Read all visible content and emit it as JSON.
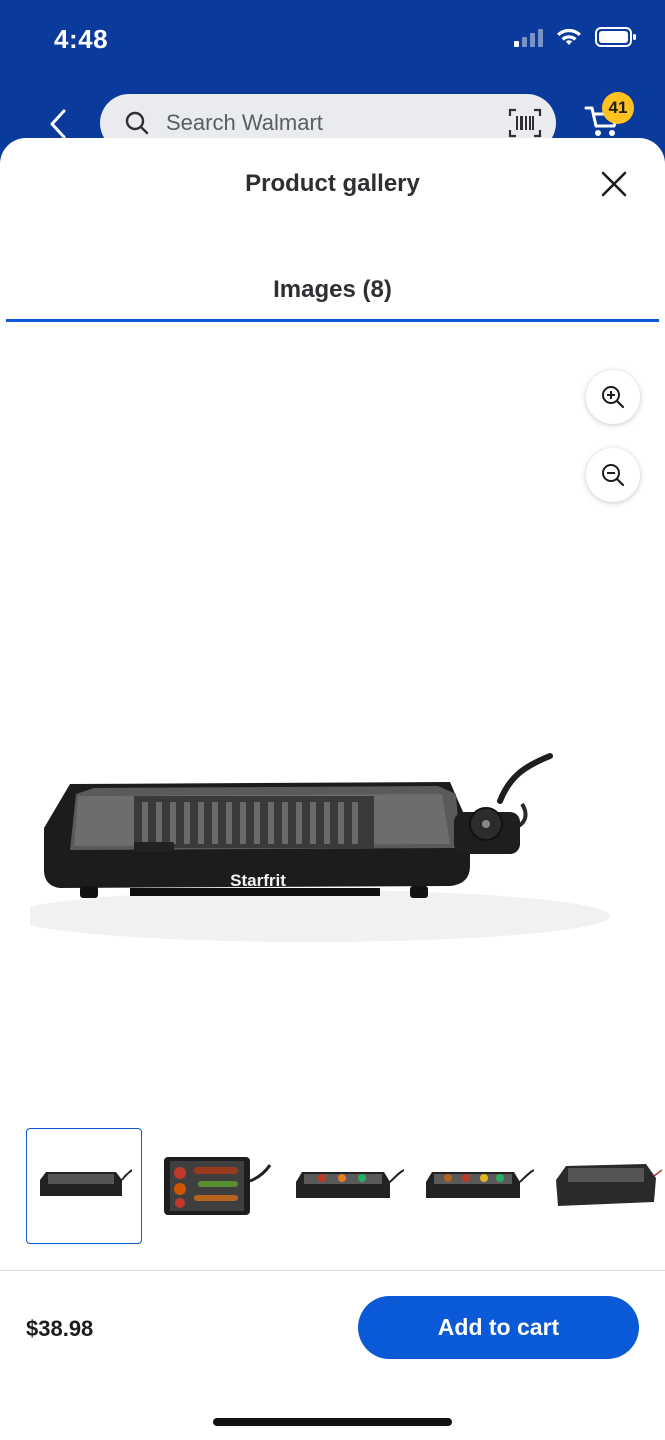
{
  "status_bar": {
    "time": "4:48"
  },
  "header": {
    "search_placeholder": "Search Walmart",
    "cart_count": "41"
  },
  "sheet": {
    "title": "Product gallery",
    "tab_label": "Images (8)"
  },
  "product": {
    "brand_on_image": "Starfrit",
    "price": "$38.98",
    "add_to_cart_label": "Add to cart"
  },
  "colors": {
    "header_blue": "#0a3a9c",
    "accent_blue": "#0a59d6",
    "badge_yellow": "#ffc220"
  },
  "icons": {
    "back": "chevron-left-icon",
    "search": "search-icon",
    "barcode": "barcode-scan-icon",
    "cart": "cart-icon",
    "close": "close-icon",
    "zoom_in": "zoom-in-icon",
    "zoom_out": "zoom-out-icon"
  }
}
